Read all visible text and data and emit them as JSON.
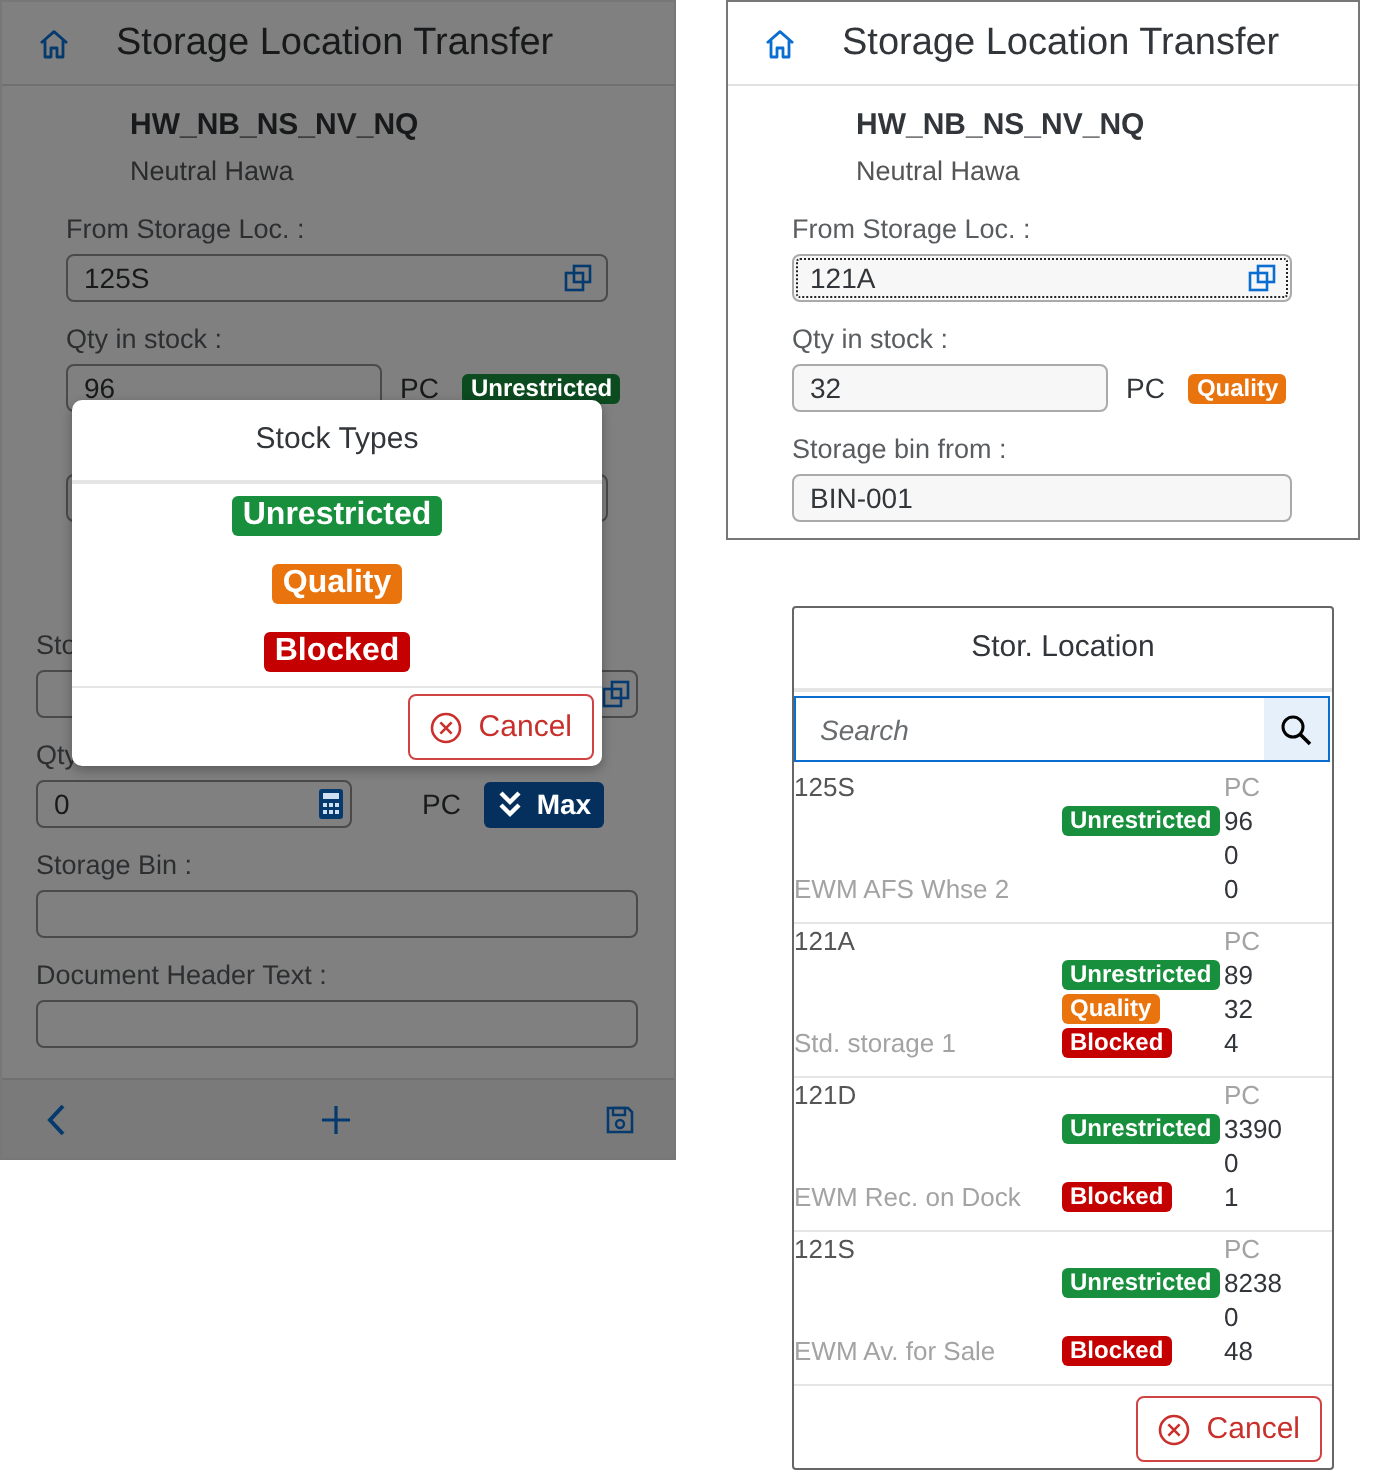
{
  "transfer_screen": {
    "title": "Storage Location Transfer",
    "material": "HW_NB_NS_NV_NQ",
    "material_description": "Neutral Hawa",
    "source_fields": [
      {
        "kind": "value_help",
        "label": "From Storage Loc. :",
        "value": "125S",
        "focused": false
      },
      {
        "kind": "stock_qty",
        "label": "Qty in stock :",
        "value": "96",
        "unit": "PC",
        "badge": {
          "label": "Unrestricted",
          "color": "#0c4a20"
        }
      },
      {
        "kind": "text"
      }
    ],
    "target_fields": [
      {
        "kind": "value_help",
        "label": "Sto",
        "focused": false
      },
      {
        "kind": "entry_qty",
        "label": "Qty",
        "value": "0",
        "unit": "PC",
        "button": "Max"
      },
      {
        "kind": "text",
        "label": "Storage Bin :"
      },
      {
        "kind": "text",
        "label": "Document Header Text :"
      }
    ]
  },
  "stock_types_dialog": {
    "title": "Stock Types",
    "stock_types": [
      {
        "label": "Unrestricted",
        "color": "#188f3d"
      },
      {
        "label": "Quality",
        "color": "#e9730c"
      },
      {
        "label": "Blocked",
        "color": "#c40000"
      }
    ],
    "cancel": "Cancel"
  },
  "detail_screen": {
    "title": "Storage Location Transfer",
    "material": "HW_NB_NS_NV_NQ",
    "material_description": "Neutral Hawa",
    "source_fields": [
      {
        "kind": "value_help",
        "label": "From Storage Loc. :",
        "value": "121A",
        "focused": true
      },
      {
        "kind": "stock_qty",
        "label": "Qty in stock :",
        "value": "32",
        "unit": "PC",
        "badge": {
          "label": "Quality",
          "color": "#e9730c"
        }
      },
      {
        "kind": "text",
        "label": "Storage bin from :",
        "value": "BIN-001"
      }
    ]
  },
  "stor_location_dialog": {
    "title": "Stor. Location",
    "search": {
      "placeholder": "Search"
    },
    "locations": [
      {
        "name": "125S",
        "unit": "PC",
        "description": "EWM AFS Whse 2",
        "stocks": [
          {
            "badge": {
              "label": "Unrestricted",
              "color": "#188f3d"
            },
            "qty": "96"
          },
          {
            "qty": "0"
          },
          {
            "qty": "0"
          }
        ]
      },
      {
        "name": "121A",
        "unit": "PC",
        "description": "Std. storage 1",
        "stocks": [
          {
            "badge": {
              "label": "Unrestricted",
              "color": "#188f3d"
            },
            "qty": "89"
          },
          {
            "badge": {
              "label": "Quality",
              "color": "#e9730c"
            },
            "qty": "32"
          },
          {
            "badge": {
              "label": "Blocked",
              "color": "#c40000"
            },
            "qty": "4"
          }
        ]
      },
      {
        "name": "121D",
        "unit": "PC",
        "description": "EWM Rec. on Dock",
        "stocks": [
          {
            "badge": {
              "label": "Unrestricted",
              "color": "#188f3d"
            },
            "qty": "3390"
          },
          {
            "qty": "0"
          },
          {
            "badge": {
              "label": "Blocked",
              "color": "#c40000"
            },
            "qty": "1"
          }
        ]
      },
      {
        "name": "121S",
        "unit": "PC",
        "description": "EWM Av. for Sale",
        "stocks": [
          {
            "badge": {
              "label": "Unrestricted",
              "color": "#188f3d"
            },
            "qty": "8238"
          },
          {
            "qty": "0"
          },
          {
            "badge": {
              "label": "Blocked",
              "color": "#c40000"
            },
            "qty": "48"
          }
        ]
      }
    ],
    "cancel": "Cancel"
  }
}
